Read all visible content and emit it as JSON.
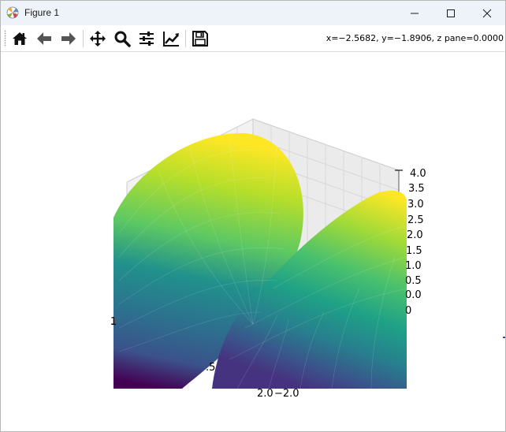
{
  "window": {
    "title": "Figure 1",
    "controls": [
      "minimize",
      "maximize",
      "close"
    ]
  },
  "toolbar": {
    "tools": [
      {
        "name": "home",
        "icon": "home-icon"
      },
      {
        "name": "back",
        "icon": "arrow-left-icon"
      },
      {
        "name": "forward",
        "icon": "arrow-right-icon"
      },
      {
        "name": "pan",
        "icon": "move-icon"
      },
      {
        "name": "zoom",
        "icon": "magnifier-icon"
      },
      {
        "name": "configure-subplots",
        "icon": "sliders-icon"
      },
      {
        "name": "edit-axis",
        "icon": "line-chart-icon"
      },
      {
        "name": "save",
        "icon": "floppy-disk-icon"
      }
    ],
    "coordinates": "x=−2.5682, y=−1.8906, z pane=0.0000"
  },
  "plot": {
    "colormap": "viridis",
    "z_ticks": [
      "4.0",
      "3.5",
      "3.0",
      "2.5",
      "2.0",
      "1.5",
      "1.0",
      "0.5",
      "0.0",
      "0"
    ],
    "bottom_ticks": [
      "2.0",
      "−2.0"
    ],
    "partial_ticks": [
      ".5",
      "1"
    ]
  }
}
